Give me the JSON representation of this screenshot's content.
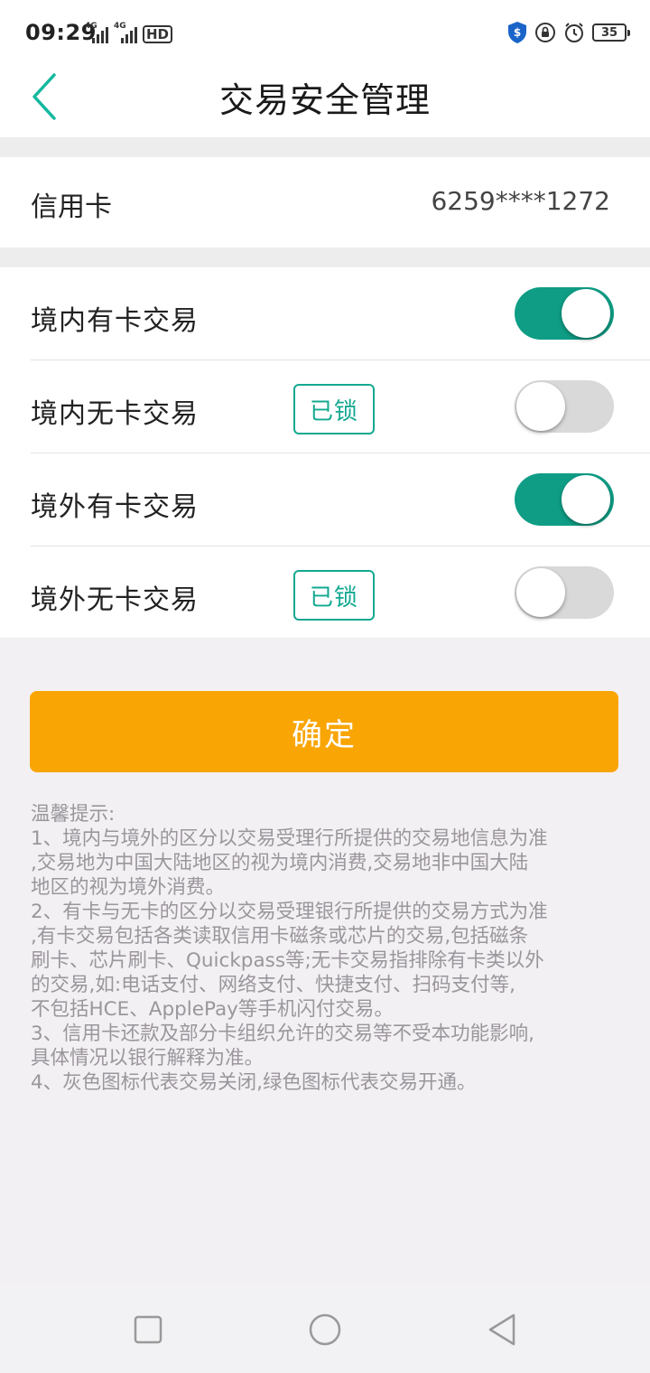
{
  "status_bar": {
    "time": "09:29",
    "network_labels": [
      "4G",
      "4G"
    ],
    "hd_label": "HD",
    "battery_level": "35",
    "icons": [
      "signal-icon",
      "hd-icon",
      "shield-icon",
      "lock-rotation-icon",
      "alarm-icon",
      "battery-icon"
    ]
  },
  "header": {
    "title": "交易安全管理",
    "back_icon": "chevron-left-icon"
  },
  "card": {
    "label": "信用卡",
    "number": "6259****1272"
  },
  "toggles": [
    {
      "label": "境内有卡交易",
      "locked": false,
      "lock_label": "",
      "state": "on"
    },
    {
      "label": "境内无卡交易",
      "locked": true,
      "lock_label": "已锁",
      "state": "off"
    },
    {
      "label": "境外有卡交易",
      "locked": false,
      "lock_label": "",
      "state": "on"
    },
    {
      "label": "境外无卡交易",
      "locked": true,
      "lock_label": "已锁",
      "state": "off"
    }
  ],
  "confirm_label": "确定",
  "tips": {
    "title": "温馨提示:",
    "lines": [
      "1、境内与境外的区分以交易受理行所提供的交易地信息为准",
      ",交易地为中国大陆地区的视为境内消费,交易地非中国大陆",
      "地区的视为境外消费。",
      "2、有卡与无卡的区分以交易受理银行所提供的交易方式为准",
      ",有卡交易包括各类读取信用卡磁条或芯片的交易,包括磁条",
      "刷卡、芯片刷卡、Quickpass等;无卡交易指排除有卡类以外",
      "的交易,如:电话支付、网络支付、快捷支付、扫码支付等,",
      "不包括HCE、ApplePay等手机闪付交易。",
      "3、信用卡还款及部分卡组织允许的交易等不受本功能影响,",
      "具体情况以银行解释为准。",
      "4、灰色图标代表交易关闭,绿色图标代表交易开通。"
    ]
  },
  "colors": {
    "accent_green": "#0f9d85",
    "confirm_orange": "#f9a504",
    "lock_badge": "#13a891",
    "switch_off": "#d9d9d9"
  },
  "system_nav": [
    "recent-apps-icon",
    "home-icon",
    "back-icon"
  ]
}
